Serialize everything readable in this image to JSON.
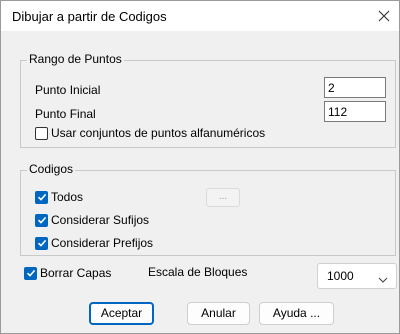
{
  "window": {
    "title": "Dibujar a partir de Codigos"
  },
  "rango": {
    "title": "Rango de Puntos",
    "punto_inicial_label": "Punto Inicial",
    "punto_inicial_value": "2",
    "punto_final_label": "Punto Final",
    "punto_final_value": "112",
    "alfanumericos_label": "Usar conjuntos de puntos alfanuméricos",
    "alfanumericos_checked": false
  },
  "codigos": {
    "title": "Codigos",
    "todos_label": "Todos",
    "todos_checked": true,
    "ellipsis_label": "...",
    "sufijos_label": "Considerar Sufijos",
    "sufijos_checked": true,
    "prefijos_label": "Considerar Prefijos",
    "prefijos_checked": true
  },
  "bottom": {
    "borrar_label": "Borrar Capas",
    "borrar_checked": true,
    "escala_label": "Escala de Bloques",
    "escala_value": "1000"
  },
  "buttons": {
    "aceptar": "Aceptar",
    "anular": "Anular",
    "ayuda": "Ayuda ..."
  },
  "colors": {
    "accent": "#0067c0"
  }
}
